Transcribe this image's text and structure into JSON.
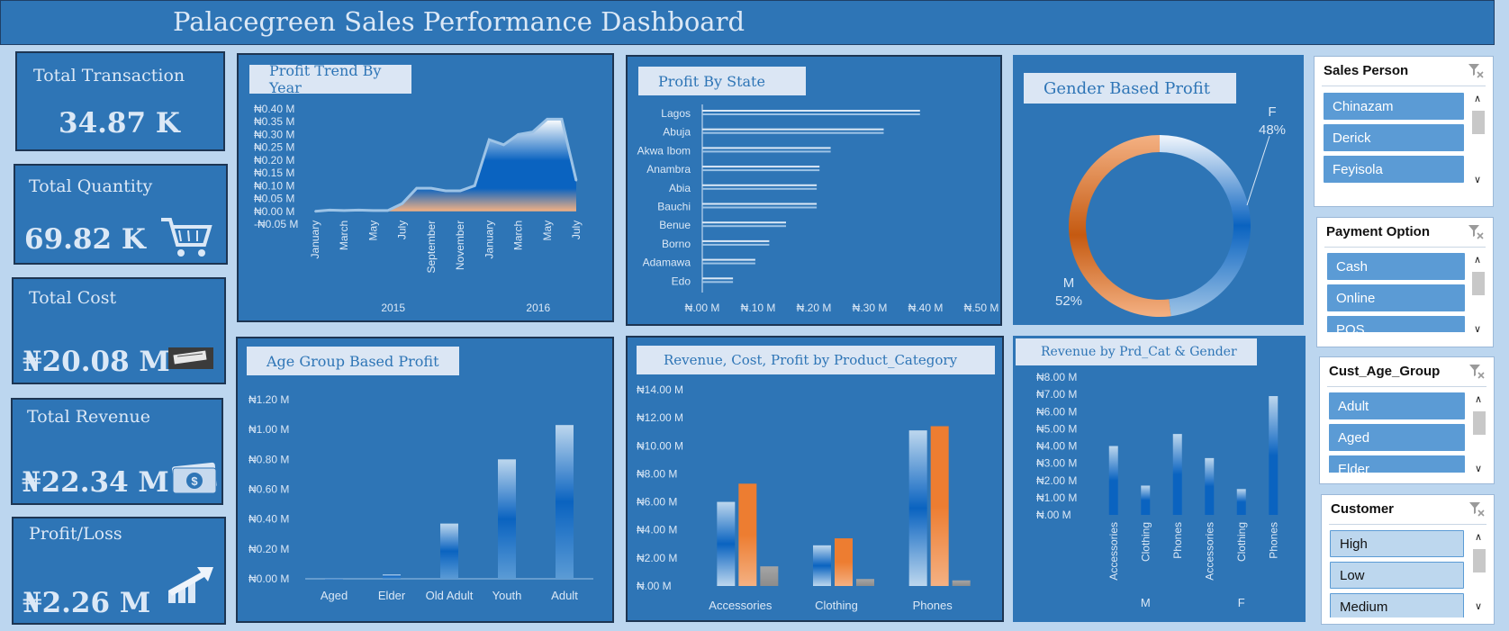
{
  "title": "Palacegreen Sales Performance Dashboard",
  "kpis": {
    "transaction": {
      "label": "Total Transaction",
      "value": "34.87 K"
    },
    "quantity": {
      "label": "Total Quantity",
      "value": "69.82 K"
    },
    "cost": {
      "label": "Total Cost",
      "value": "₦20.08 M"
    },
    "revenue": {
      "label": "Total Revenue",
      "value": "₦22.34 M"
    },
    "profit": {
      "label": "Profit/Loss",
      "value": "₦2.26 M"
    }
  },
  "icons": {
    "quantity": "shopping-cart-icon",
    "cost": "cost-image-icon",
    "revenue": "money-stack-icon",
    "profit": "profit-arrow-icon",
    "slicer_clear": "clear-filter-icon"
  },
  "colors": {
    "panel": "#2e75b6",
    "background": "#bcd6ef",
    "orange": "#ed7d31",
    "light_blue": "#9dc3e6",
    "gray": "#a5a5a5"
  },
  "chart_data": [
    {
      "id": "trend",
      "type": "area",
      "title": "Profit Trend By Year",
      "y_ticks": [
        "₦0.40 M",
        "₦0.35 M",
        "₦0.30 M",
        "₦0.25 M",
        "₦0.20 M",
        "₦0.15 M",
        "₦0.10 M",
        "₦0.05 M",
        "₦0.00 M",
        "-₦0.05 M"
      ],
      "ylim": [
        -0.05,
        0.4
      ],
      "x_tick_labels": [
        "January",
        "March",
        "May",
        "July",
        "September",
        "November",
        "January",
        "March",
        "May",
        "July"
      ],
      "groups": [
        {
          "label": "2015"
        },
        {
          "label": "2016"
        }
      ],
      "x": [
        "2015-01",
        "2015-02",
        "2015-03",
        "2015-04",
        "2015-05",
        "2015-06",
        "2015-07",
        "2015-08",
        "2015-09",
        "2015-10",
        "2015-11",
        "2015-12",
        "2016-01",
        "2016-02",
        "2016-03",
        "2016-04",
        "2016-05",
        "2016-06",
        "2016-07"
      ],
      "values": [
        0.0,
        0.005,
        0.003,
        0.005,
        0.003,
        0.003,
        0.03,
        0.09,
        0.09,
        0.08,
        0.08,
        0.1,
        0.28,
        0.26,
        0.3,
        0.31,
        0.36,
        0.36,
        0.12
      ]
    },
    {
      "id": "state",
      "type": "bar",
      "orientation": "horizontal",
      "title": "Profit By State",
      "categories": [
        "Lagos",
        "Abuja",
        "Akwa Ibom",
        "Anambra",
        "Abia",
        "Bauchi",
        "Benue",
        "Borno",
        "Adamawa",
        "Edo"
      ],
      "values": [
        0.39,
        0.325,
        0.23,
        0.21,
        0.205,
        0.205,
        0.15,
        0.12,
        0.095,
        0.055
      ],
      "x_ticks": [
        "₦.00 M",
        "₦.10 M",
        "₦.20 M",
        "₦.30 M",
        "₦.40 M",
        "₦.50 M"
      ],
      "xlim": [
        0,
        0.5
      ]
    },
    {
      "id": "gender",
      "type": "pie",
      "title": "Gender Based Profit",
      "slices": [
        {
          "name": "F",
          "pct": 48,
          "label": "48%"
        },
        {
          "name": "M",
          "pct": 52,
          "label": "52%"
        }
      ]
    },
    {
      "id": "age",
      "type": "bar",
      "title": "Age Group Based Profit",
      "categories": [
        "Aged",
        "Elder",
        "Old Adult",
        "Youth",
        "Adult"
      ],
      "values": [
        0.0,
        0.03,
        0.37,
        0.8,
        1.03
      ],
      "y_ticks": [
        "₦1.20 M",
        "₦1.00 M",
        "₦0.80 M",
        "₦0.60 M",
        "₦0.40 M",
        "₦0.20 M",
        "₦0.00 M"
      ],
      "ylim": [
        0,
        1.2
      ]
    },
    {
      "id": "category",
      "type": "bar",
      "title": "Revenue, Cost, Profit by Product_Category",
      "categories": [
        "Accessories",
        "Clothing",
        "Phones"
      ],
      "series": [
        {
          "values": [
            6.0,
            2.9,
            11.1
          ]
        },
        {
          "values": [
            7.3,
            3.4,
            11.4
          ]
        },
        {
          "values": [
            1.4,
            0.5,
            0.4
          ]
        }
      ],
      "y_ticks": [
        "₦14.00 M",
        "₦12.00 M",
        "₦10.00 M",
        "₦8.00 M",
        "₦6.00 M",
        "₦4.00 M",
        "₦2.00 M",
        "₦.00 M"
      ],
      "ylim": [
        0,
        14
      ]
    },
    {
      "id": "prdgender",
      "type": "bar",
      "title": "Revenue by Prd_Cat & Gender",
      "groups": [
        {
          "label": "M",
          "categories": [
            "Accessories",
            "Clothing",
            "Phones"
          ],
          "values": [
            4.0,
            1.7,
            4.7
          ]
        },
        {
          "label": "F",
          "categories": [
            "Accessories",
            "Clothing",
            "Phones"
          ],
          "values": [
            3.3,
            1.5,
            6.9
          ]
        }
      ],
      "y_ticks": [
        "₦8.00 M",
        "₦7.00 M",
        "₦6.00 M",
        "₦5.00 M",
        "₦4.00 M",
        "₦3.00 M",
        "₦2.00 M",
        "₦1.00 M",
        "₦.00 M"
      ],
      "ylim": [
        0,
        8
      ]
    }
  ],
  "slicers": [
    {
      "id": "sales",
      "title": "Sales Person",
      "items": [
        "Chinazam",
        "Derick",
        "Feyisola"
      ],
      "partial": "K"
    },
    {
      "id": "payment",
      "title": "Payment Option",
      "items": [
        "Cash",
        "Online",
        "POS"
      ]
    },
    {
      "id": "agegroup",
      "title": "Cust_Age_Group",
      "items": [
        "Adult",
        "Aged",
        "Elder"
      ]
    },
    {
      "id": "customer",
      "title": "Customer",
      "items": [
        "High",
        "Low",
        "Medium"
      ]
    }
  ]
}
